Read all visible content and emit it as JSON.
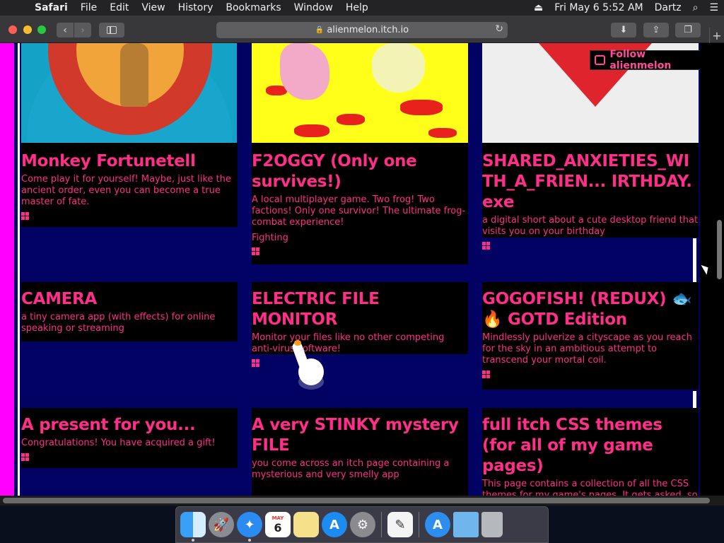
{
  "menubar": {
    "app": "Safari",
    "items": [
      "File",
      "Edit",
      "View",
      "History",
      "Bookmarks",
      "Window",
      "Help"
    ],
    "clock": "Fri May 6  5:52 AM",
    "user": "Dartz"
  },
  "toolbar": {
    "url": "alienmelon.itch.io"
  },
  "follow_label": "Follow alienmelon",
  "games": [
    {
      "title": "Monkey Fortunetell",
      "desc": "Come play it for yourself! Maybe, just like the ancient order, even you can become a true master of fate.",
      "genre": ""
    },
    {
      "title": "F2OGGY (Only one survives!)",
      "desc": "A local multiplayer game. Two frog! Two factions! Only one survivor! The ultimate frog-combat experience!",
      "genre": "Fighting"
    },
    {
      "title": "SHARED_ANXIETIES_WITH_A_FRIEN... IRTHDAY.exe",
      "desc": "a digital short about a cute desktop friend that visits you on your birthday",
      "genre": ""
    },
    {
      "title": "CAMERA",
      "desc": "a tiny camera app (with effects) for online speaking or streaming",
      "genre": ""
    },
    {
      "title": "ELECTRIC FILE MONITOR",
      "desc": "Monitor your files like no other competing anti-virus software!",
      "genre": ""
    },
    {
      "title": "GOGOFISH! (REDUX) 🐟🔥 GOTD Edition",
      "desc": "Mindlessly pulverize a cityscape as you reach for the sky in an ambitious attempt to transcend your mortal coil.",
      "genre": ""
    },
    {
      "title": "A present for you...",
      "desc": "Congratulations! You have acquired a gift!",
      "genre": ""
    },
    {
      "title": "A very STINKY mystery FILE",
      "desc": "you come across an itch page containing a mysterious and very smelly app",
      "genre": ""
    },
    {
      "title": "full itch CSS themes (for all of my game pages)",
      "desc": "This page contains a collection of all the CSS themes for my game's pages. It gets asked, so I'm sharing them all.",
      "genre": ""
    }
  ],
  "dock": {
    "calendar_month": "MAY",
    "calendar_day": "6"
  },
  "colors": {
    "accent": "#ff2e88",
    "page_bg": "#020264",
    "side_bar": "#ff00ff"
  }
}
